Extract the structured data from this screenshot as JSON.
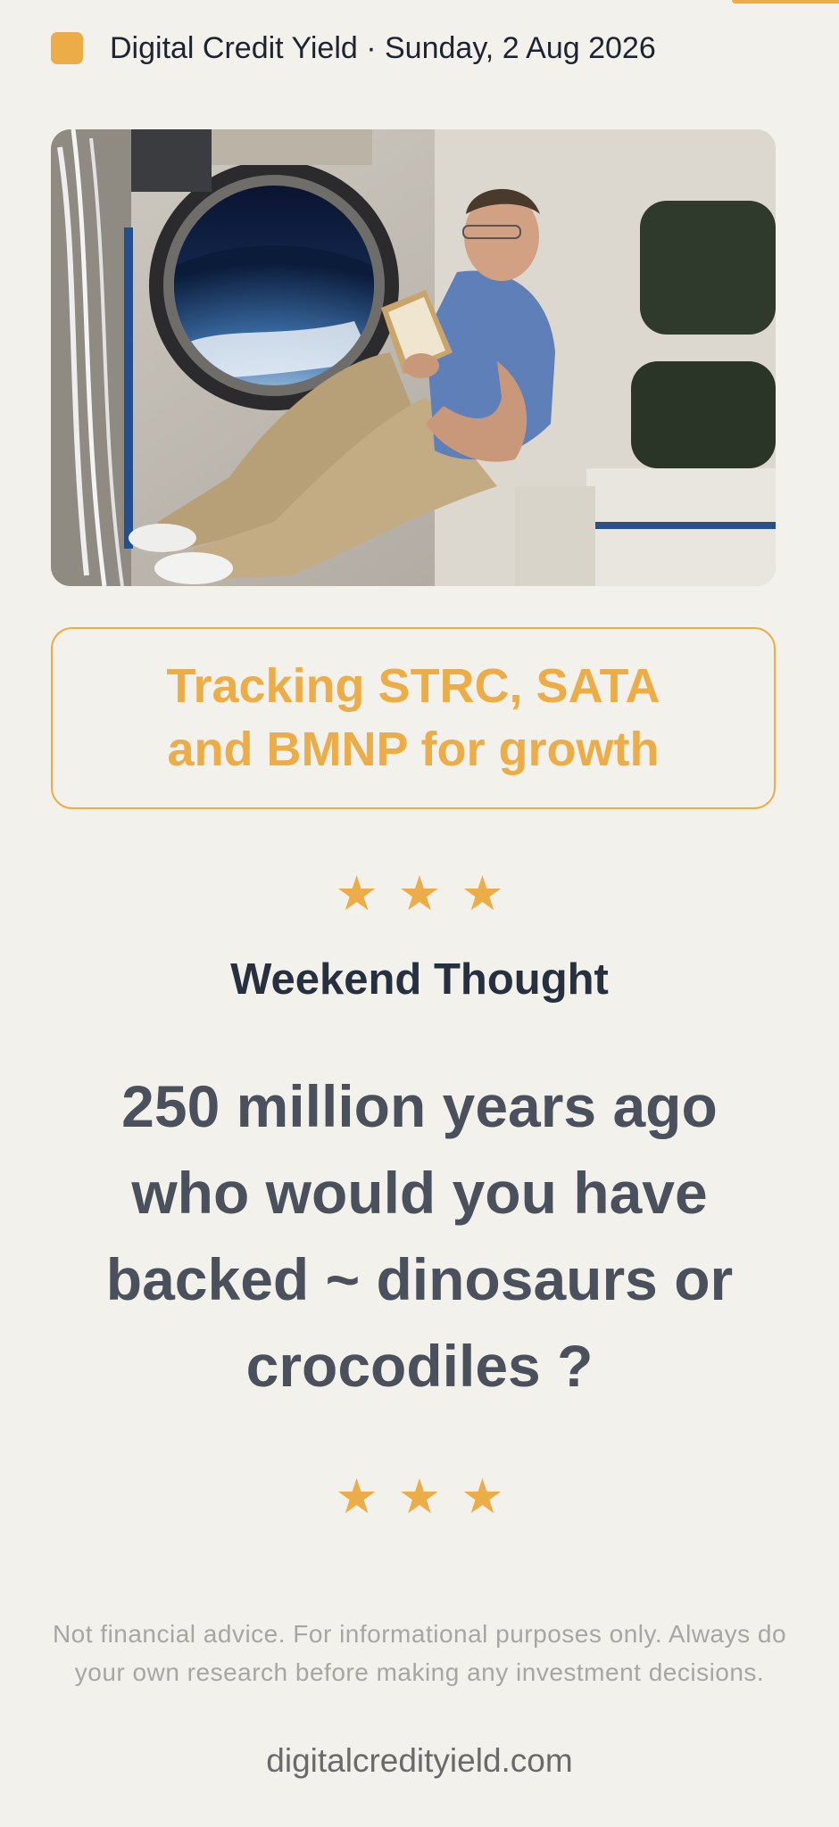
{
  "header": {
    "text": "Digital Credit Yield · Sunday, 2 Aug 2026"
  },
  "headline": "Tracking STRC, SATA and BMNP for growth",
  "stars": "★★★",
  "section_title": "Weekend Thought",
  "thought": "250 million years ago who would you have backed ~ dinosaurs or crocodiles ?",
  "disclaimer": "Not financial advice. For informational purposes only. Always do your own research before making any investment decisions.",
  "site": "digitalcredityield.com",
  "colors": {
    "accent": "#ecac48",
    "background": "#f3f1ec",
    "text_dark": "#2d3544",
    "text_muted": "#a6a6a3"
  }
}
